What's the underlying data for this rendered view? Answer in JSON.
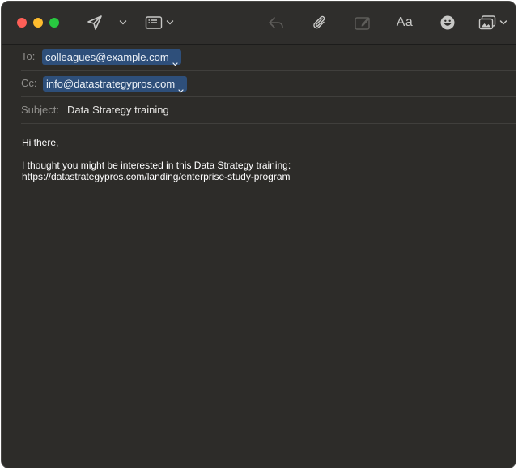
{
  "window": {
    "traffic_lights": [
      "close",
      "minimize",
      "zoom"
    ]
  },
  "toolbar": {
    "icons": [
      {
        "name": "send-icon",
        "enabled": true
      },
      {
        "name": "chevron-down-icon",
        "enabled": true
      },
      {
        "name": "header-fields-icon",
        "enabled": true
      },
      {
        "name": "reply-icon",
        "enabled": false
      },
      {
        "name": "paperclip-icon",
        "enabled": true
      },
      {
        "name": "markup-icon",
        "enabled": false
      },
      {
        "name": "emoji-icon",
        "enabled": true
      },
      {
        "name": "photo-browser-icon",
        "enabled": true
      }
    ],
    "format_label": "Aa"
  },
  "headers": {
    "to_label": "To:",
    "to_value": "colleagues@example.com",
    "cc_label": "Cc:",
    "cc_value": "info@datastrategypros.com",
    "subject_label": "Subject:",
    "subject_value": "Data Strategy training"
  },
  "message": {
    "greeting": "Hi there,",
    "line1": "I thought you might be interested in this Data Strategy training:",
    "line2": "https://datastrategypros.com/landing/enterprise-study-program"
  },
  "colors": {
    "window_bg": "#2d2c29",
    "chip_bg": "#2e4f7a",
    "close": "#fe5f57",
    "minimize": "#febc2e",
    "zoom": "#28c840"
  }
}
